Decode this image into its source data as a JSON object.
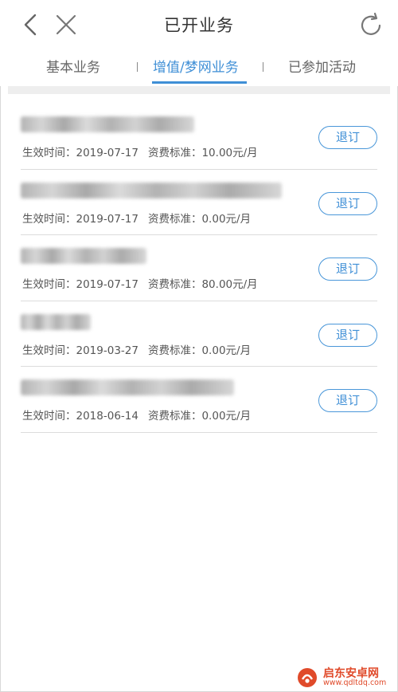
{
  "header": {
    "title": "已开业务",
    "back_icon": "chevron-left-icon",
    "close_icon": "close-icon",
    "refresh_icon": "refresh-icon"
  },
  "tabs": [
    {
      "label": "基本业务",
      "active": false
    },
    {
      "label": "增值/梦网业务",
      "active": true
    },
    {
      "label": "已参加活动",
      "active": false
    }
  ],
  "colors": {
    "accent": "#3f8fd6",
    "divider": "#dcdcdc",
    "watermark": "#e04a2a"
  },
  "services": [
    {
      "effective_label": "生效时间：2019-07-17",
      "fee_label": "资费标准：10.00元/月",
      "action": "退订"
    },
    {
      "effective_label": "生效时间：2019-07-17",
      "fee_label": "资费标准：0.00元/月",
      "action": "退订"
    },
    {
      "effective_label": "生效时间：2019-07-17",
      "fee_label": "资费标准：80.00元/月",
      "action": "退订"
    },
    {
      "effective_label": "生效时间：2019-03-27",
      "fee_label": "资费标准：0.00元/月",
      "action": "退订"
    },
    {
      "effective_label": "生效时间：2018-06-14",
      "fee_label": "资费标准：0.00元/月",
      "action": "退订"
    }
  ],
  "watermark": {
    "title": "启东安卓网",
    "url": "www.qdltdq.com"
  }
}
